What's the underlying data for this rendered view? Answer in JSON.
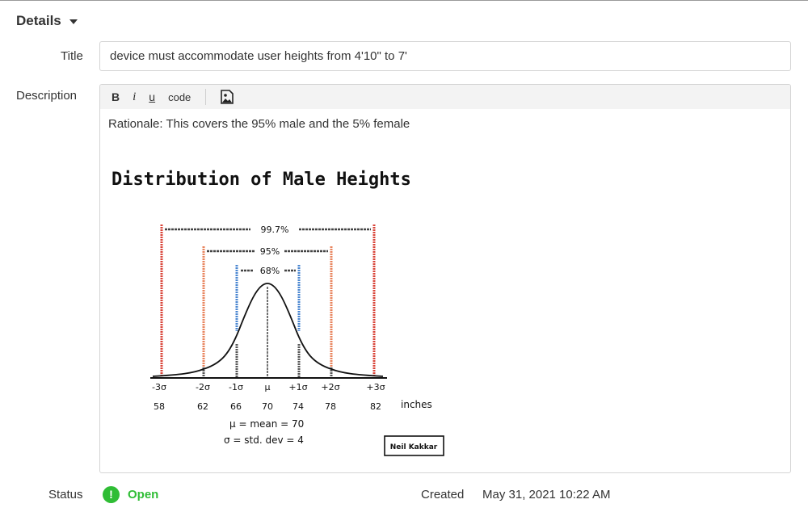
{
  "section": {
    "title": "Details"
  },
  "fields": {
    "title_label": "Title",
    "title_value": "device must accommodate user heights from 4'10\" to 7'",
    "description_label": "Description",
    "status_label": "Status",
    "status_value": "Open",
    "created_label": "Created",
    "created_value": "May 31, 2021 10:22 AM"
  },
  "toolbar": {
    "bold": "B",
    "italic": "i",
    "underline": "u",
    "code": "code",
    "image_icon": "image-icon"
  },
  "description": {
    "text": "Rationale: This covers the 95% male and the 5% female",
    "figure": {
      "title": "Distribution of Male Heights",
      "pct_997": "99.7%",
      "pct_95": "95%",
      "pct_68": "68%",
      "sigma_labels": [
        "-3σ",
        "-2σ",
        "-1σ",
        "μ",
        "+1σ",
        "+2σ",
        "+3σ"
      ],
      "values": [
        "58",
        "62",
        "66",
        "70",
        "74",
        "78",
        "82"
      ],
      "unit": "inches",
      "legend_mean": "μ = mean = 70",
      "legend_sd": "σ = std. dev = 4",
      "signature": "Neil Kakkar",
      "colors": {
        "sd3": "#d9453a",
        "sd2": "#e8845e",
        "sd1": "#4a86d0"
      }
    }
  },
  "status_color": "#2fbd35"
}
